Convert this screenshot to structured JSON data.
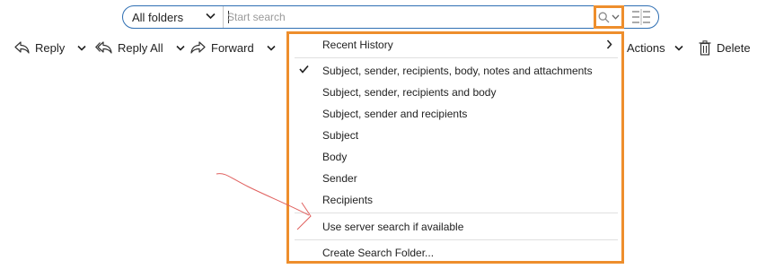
{
  "search": {
    "folder_scope": "All folders",
    "placeholder": "Start search",
    "icons": {
      "search": "search-icon",
      "dropdown": "chevron-down-icon",
      "filter": "filter-icon"
    }
  },
  "ribbon": {
    "reply": "Reply",
    "reply_all": "Reply All",
    "forward": "Forward",
    "actions": "Actions",
    "delete": "Delete"
  },
  "menu": {
    "recent_history": "Recent History",
    "items": [
      {
        "label": "Subject, sender, recipients, body, notes and attachments",
        "checked": true
      },
      {
        "label": "Subject, sender, recipients and body",
        "checked": false
      },
      {
        "label": "Subject, sender and recipients",
        "checked": false
      },
      {
        "label": "Subject",
        "checked": false
      },
      {
        "label": "Body",
        "checked": false
      },
      {
        "label": "Sender",
        "checked": false
      },
      {
        "label": "Recipients",
        "checked": false
      }
    ],
    "server_search": "Use server search if available",
    "create_folder": "Create Search Folder..."
  },
  "colors": {
    "highlight": "#ee8e2c",
    "search_border": "#2f6fb3",
    "annotation": "#e0605e"
  }
}
